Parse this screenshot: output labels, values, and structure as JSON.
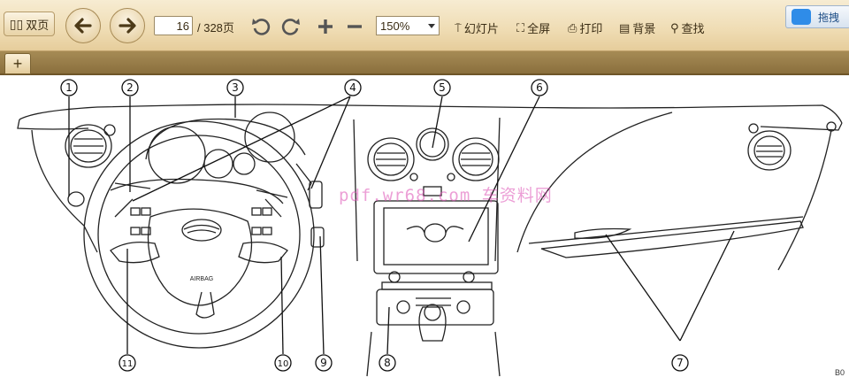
{
  "toolbar": {
    "dual_page_label": "双页",
    "page_current": "16",
    "page_total": "/ 328页",
    "zoom_value": "150%",
    "slideshow_label": "幻灯片",
    "fullscreen_label": "全屏",
    "print_label": "打印",
    "background_label": "背景",
    "find_label": "查找",
    "baidu_label": "拖拽"
  },
  "tabs": {
    "add_label": "+"
  },
  "diagram": {
    "callouts": [
      "1",
      "2",
      "3",
      "4",
      "5",
      "6",
      "7",
      "8",
      "9",
      "10",
      "11"
    ],
    "airbag_text": "AIRBAG",
    "watermark": "pdf.wr68.com 车资料网",
    "corner_code": "B0"
  },
  "colors": {
    "toolbar_bg": "#efdcb3",
    "tabbar_bg": "#9b8048",
    "watermark": "#dc50b4"
  }
}
